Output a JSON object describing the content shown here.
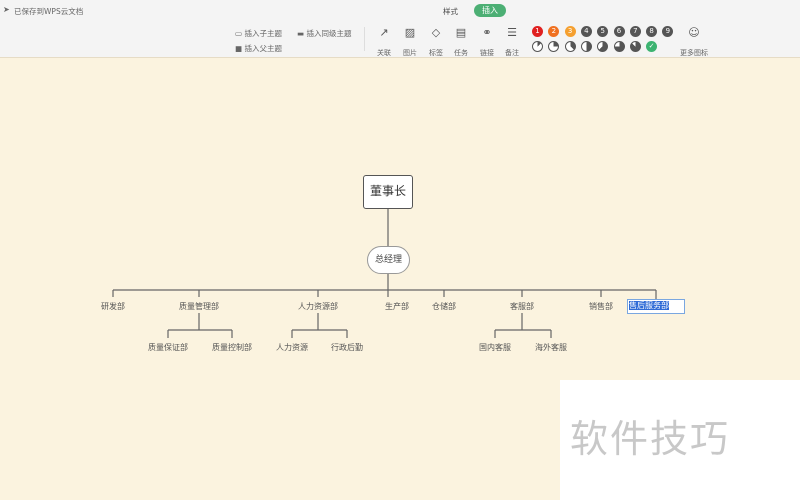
{
  "header": {
    "save_status": "已保存到WPS云文档",
    "tabs": [
      {
        "label": "样式"
      },
      {
        "label": "插入",
        "active": true
      }
    ]
  },
  "toolbar": {
    "insert_child": "插入子主题",
    "insert_sibling": "插入同级主题",
    "insert_parent": "插入父主题",
    "tools": [
      {
        "label": "关联",
        "icon": "relation-arrow-icon"
      },
      {
        "label": "图片",
        "icon": "image-icon"
      },
      {
        "label": "标签",
        "icon": "tag-icon"
      },
      {
        "label": "任务",
        "icon": "task-icon"
      },
      {
        "label": "链接",
        "icon": "link-icon"
      },
      {
        "label": "备注",
        "icon": "note-icon"
      }
    ],
    "priorities": [
      "1",
      "2",
      "3",
      "4",
      "5",
      "6",
      "7",
      "8",
      "9"
    ],
    "priority_colors": [
      "#e02020",
      "#f07020",
      "#f5a030",
      "#555555",
      "#555555",
      "#555555",
      "#555555",
      "#555555",
      "#555555"
    ],
    "progress": [
      "1/8",
      "2/8",
      "3/8",
      "4/8",
      "5/8",
      "6/8",
      "7/8",
      "done"
    ],
    "more_icons": "更多图标"
  },
  "mindmap": {
    "root": "董事长",
    "manager": "总经理",
    "departments": [
      "研发部",
      "质量管理部",
      "人力资源部",
      "生产部",
      "仓储部",
      "客服部",
      "销售部"
    ],
    "editing": "售后服务部",
    "sub_quality": [
      "质量保证部",
      "质量控制部"
    ],
    "sub_hr": [
      "人力资源",
      "行政后勤"
    ],
    "sub_service": [
      "国内客服",
      "海外客服"
    ]
  },
  "watermark": "软件技巧"
}
